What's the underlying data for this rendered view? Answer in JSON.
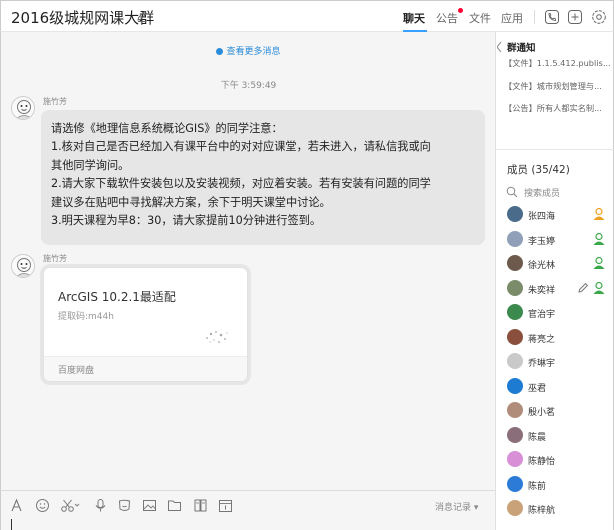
{
  "header": {
    "title": "2016级城规网课大群",
    "tabs": [
      {
        "label": "聊天",
        "active": true
      },
      {
        "label": "公告",
        "active": false,
        "badge": true
      },
      {
        "label": "文件",
        "active": false
      },
      {
        "label": "应用",
        "active": false
      }
    ],
    "icons": [
      "edit-icon",
      "phone-icon",
      "add-member-icon",
      "settings-icon"
    ]
  },
  "chat": {
    "load_more": "查看更多消息",
    "timestamp": "下午 3:59:49",
    "messages": [
      {
        "sender": "施竹芳",
        "lines": [
          "请选修《地理信息系统概论GIS》的同学注意：",
          "1.核对自己是否已经加入有课平台中的对对应课堂，若未进入，请私信我或向",
          "其他同学询问。",
          "2.请大家下载软件安装包以及安装视频，对应着安装。若有安装有问题的同学",
          "建议多在贴吧中寻找解决方案，余下于明天课堂中讨论。",
          "3.明天课程为早8：30，请大家提前10分钟进行签到。"
        ]
      },
      {
        "sender": "施竹芳",
        "file": {
          "name": "ArcGIS 10.2.1最适配",
          "code": "提取码:m44h",
          "source": "百度网盘"
        }
      }
    ]
  },
  "toolbar": {
    "icons": [
      "font-icon",
      "emoji-icon",
      "scissors-icon",
      "voice-icon",
      "shake-icon",
      "image-icon",
      "folder-icon",
      "doc-icon",
      "calendar-icon"
    ],
    "history_label": "消息记录 ▾"
  },
  "notices": {
    "title": "群通知",
    "items": [
      "【文件】1.1.5.412.publis...",
      "【文件】城市规划管理与...",
      "【公告】所有人都实名制..."
    ]
  },
  "members": {
    "title": "成员 (35/42)",
    "search_placeholder": "搜索成员",
    "list": [
      {
        "name": "张四海",
        "color": "#4a6b8a",
        "role": "owner"
      },
      {
        "name": "李玉婷",
        "color": "#8fa0b8",
        "role": "admin"
      },
      {
        "name": "徐光林",
        "color": "#6d5a4c",
        "role": "admin"
      },
      {
        "name": "朱奕祥",
        "color": "#7a8c6a",
        "role": "admin-editing"
      },
      {
        "name": "官治宇",
        "color": "#3d8a4f",
        "role": ""
      },
      {
        "name": "蒋亮之",
        "color": "#8a4f3d",
        "role": ""
      },
      {
        "name": "乔琳宇",
        "color": "#c9c9c9",
        "role": ""
      },
      {
        "name": "巫君",
        "color": "#1d7bd1",
        "role": ""
      },
      {
        "name": "殷小茗",
        "color": "#b08c7a",
        "role": ""
      },
      {
        "name": "陈晨",
        "color": "#8a6f7a",
        "role": ""
      },
      {
        "name": "陈静怡",
        "color": "#d88fd6",
        "role": ""
      },
      {
        "name": "陈前",
        "color": "#2c7bd6",
        "role": ""
      },
      {
        "name": "陈梓航",
        "color": "#caa27a",
        "role": ""
      }
    ]
  }
}
